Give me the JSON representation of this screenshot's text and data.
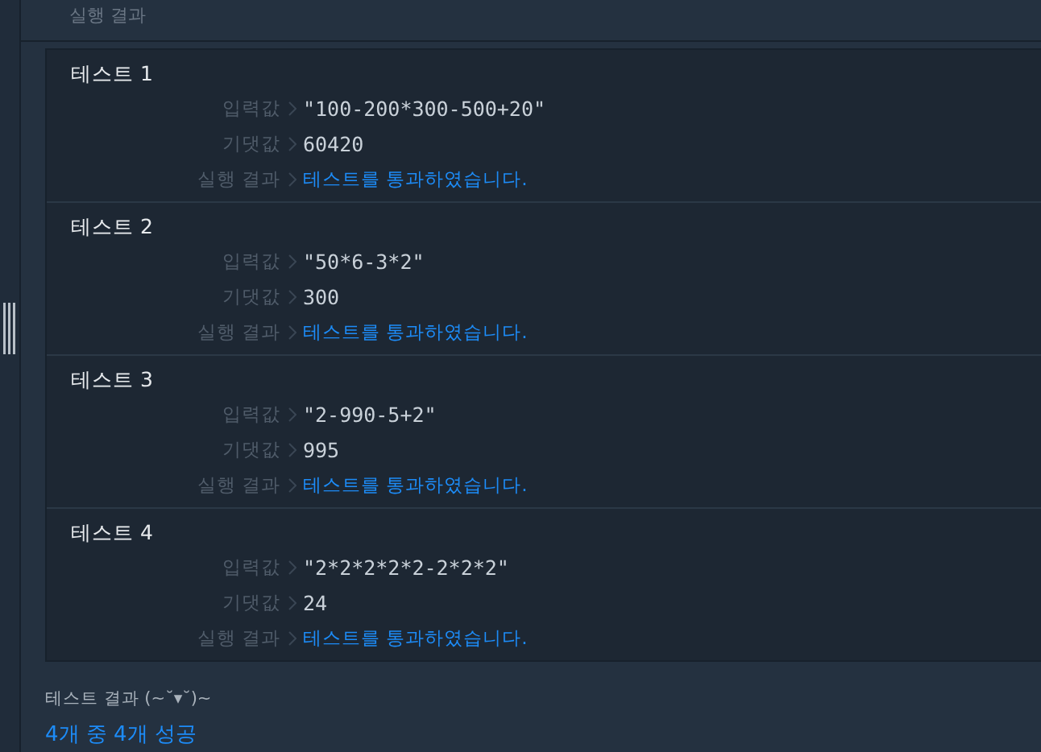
{
  "header": {
    "title": "실행 결과"
  },
  "tests": [
    {
      "title": "테스트 1",
      "rows": [
        {
          "label": "입력값",
          "value": "\"100-200*300-500+20\"",
          "kind": "plain"
        },
        {
          "label": "기댓값",
          "value": "60420",
          "kind": "plain"
        },
        {
          "label": "실행 결과",
          "value": "테스트를 통과하였습니다.",
          "kind": "pass"
        }
      ]
    },
    {
      "title": "테스트 2",
      "rows": [
        {
          "label": "입력값",
          "value": "\"50*6-3*2\"",
          "kind": "plain"
        },
        {
          "label": "기댓값",
          "value": "300",
          "kind": "plain"
        },
        {
          "label": "실행 결과",
          "value": "테스트를 통과하였습니다.",
          "kind": "pass"
        }
      ]
    },
    {
      "title": "테스트 3",
      "rows": [
        {
          "label": "입력값",
          "value": "\"2-990-5+2\"",
          "kind": "plain"
        },
        {
          "label": "기댓값",
          "value": "995",
          "kind": "plain"
        },
        {
          "label": "실행 결과",
          "value": "테스트를 통과하였습니다.",
          "kind": "pass"
        }
      ]
    },
    {
      "title": "테스트 4",
      "rows": [
        {
          "label": "입력값",
          "value": "\"2*2*2*2*2-2*2*2\"",
          "kind": "plain"
        },
        {
          "label": "기댓값",
          "value": "24",
          "kind": "plain"
        },
        {
          "label": "실행 결과",
          "value": "테스트를 통과하였습니다.",
          "kind": "pass"
        }
      ]
    }
  ],
  "summary": {
    "title": "테스트 결과 (~˘▾˘)~",
    "result": "4개 중 4개 성공"
  }
}
